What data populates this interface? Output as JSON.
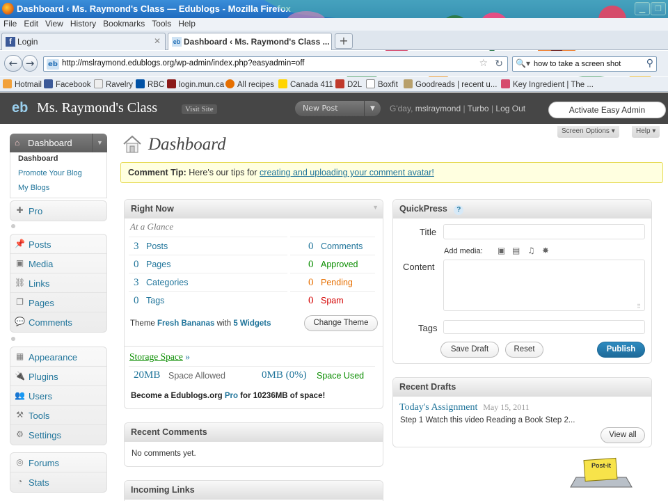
{
  "browser": {
    "title": "Dashboard ‹ Ms. Raymond's Class — Edublogs - Mozilla Firefox",
    "menus": [
      "File",
      "Edit",
      "View",
      "History",
      "Bookmarks",
      "Tools",
      "Help"
    ],
    "tabs": [
      {
        "label": "Login",
        "icon": "facebook-icon"
      },
      {
        "label": "Dashboard ‹ Ms. Raymond's Class ...",
        "icon": "edublogs-icon"
      }
    ],
    "url": "http://mslraymond.edublogs.org/wp-admin/index.php?easyadmin=off",
    "search": "how to take a screen shot",
    "bookmarks": [
      "Hotmail",
      "Facebook",
      "Ravelry",
      "RBC",
      "login.mun.ca",
      "All recipes",
      "Canada 411",
      "D2L",
      "Boxfit",
      "Goodreads | recent u...",
      "Key Ingredient | The ..."
    ]
  },
  "wp": {
    "site_name": "Ms. Raymond's Class",
    "visit_site": "Visit Site",
    "new_post": "New Post",
    "greeting_prefix": "G'day,",
    "user": "mslraymond",
    "turbo": "Turbo",
    "logout": "Log Out",
    "easy_admin": "Activate Easy Admin",
    "screen_options": "Screen Options",
    "help": "Help",
    "sidebar": {
      "dashboard": "Dashboard",
      "dashboard_sub": [
        "Dashboard",
        "Promote Your Blog",
        "My Blogs"
      ],
      "pro": "Pro",
      "group2": [
        "Posts",
        "Media",
        "Links",
        "Pages",
        "Comments"
      ],
      "group3": [
        "Appearance",
        "Plugins",
        "Users",
        "Tools",
        "Settings"
      ],
      "group4": [
        "Forums",
        "Stats"
      ]
    },
    "page_title": "Dashboard",
    "tip": {
      "label": "Comment Tip:",
      "text": "Here's our tips for",
      "link": "creating and uploading your comment avatar!"
    },
    "right_now": {
      "title": "Right Now",
      "subtitle": "At a Glance",
      "content": [
        {
          "num": "3",
          "label": "Posts"
        },
        {
          "num": "0",
          "label": "Pages"
        },
        {
          "num": "3",
          "label": "Categories"
        },
        {
          "num": "0",
          "label": "Tags"
        }
      ],
      "discussion": [
        {
          "num": "0",
          "label": "Comments",
          "color": "#21759b"
        },
        {
          "num": "0",
          "label": "Approved",
          "color": "#0a8d00"
        },
        {
          "num": "0",
          "label": "Pending",
          "color": "#e66f00"
        },
        {
          "num": "0",
          "label": "Spam",
          "color": "#d40000"
        }
      ],
      "theme_prefix": "Theme",
      "theme": "Fresh Bananas",
      "theme_with": "with",
      "widgets": "5 Widgets",
      "change_theme": "Change Theme",
      "storage_link": "Storage Space",
      "storage_arrow": "»",
      "allowed_num": "20MB",
      "allowed_label": "Space Allowed",
      "used_num": "0MB (0%)",
      "used_label": "Space Used",
      "promo_a": "Become a Edublogs.org",
      "promo_pro": "Pro",
      "promo_b": "for 10236MB of space!"
    },
    "recent_comments": {
      "title": "Recent Comments",
      "text": "No comments yet."
    },
    "incoming_links": {
      "title": "Incoming Links"
    },
    "quickpress": {
      "title": "QuickPress",
      "help": "?",
      "title_label": "Title",
      "add_media": "Add media:",
      "content_label": "Content",
      "tags_label": "Tags",
      "save_draft": "Save Draft",
      "reset": "Reset",
      "publish": "Publish"
    },
    "recent_drafts": {
      "title": "Recent Drafts",
      "draft_title": "Today's Assignment",
      "draft_date": "May 15, 2011",
      "draft_excerpt": "Step 1 Watch this video Reading a Book Step 2...",
      "view_all": "View all"
    },
    "postit": "Post-it"
  }
}
